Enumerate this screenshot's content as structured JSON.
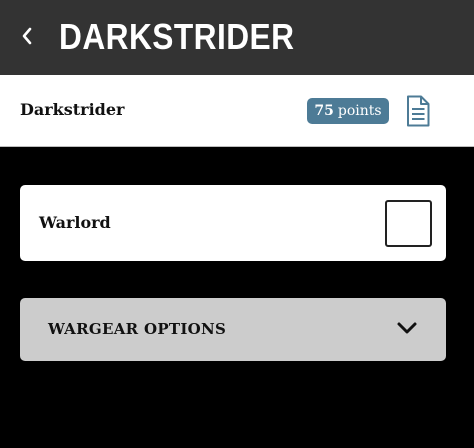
{
  "header": {
    "title": "DARKSTRIDER",
    "back_icon": "chevron-left-icon"
  },
  "unit": {
    "name": "Darkstrider",
    "points_value": "75",
    "points_unit": "points",
    "doc_icon": "document-icon"
  },
  "warlord": {
    "label": "Warlord",
    "checked": false
  },
  "wargear": {
    "label": "WARGEAR OPTIONS",
    "expand_icon": "chevron-down-icon"
  },
  "colors": {
    "header_bg": "#333333",
    "background": "#000000",
    "badge": "#4d7b96",
    "doc_icon": "#4d7b96",
    "panel_bg": "#cccccc"
  }
}
